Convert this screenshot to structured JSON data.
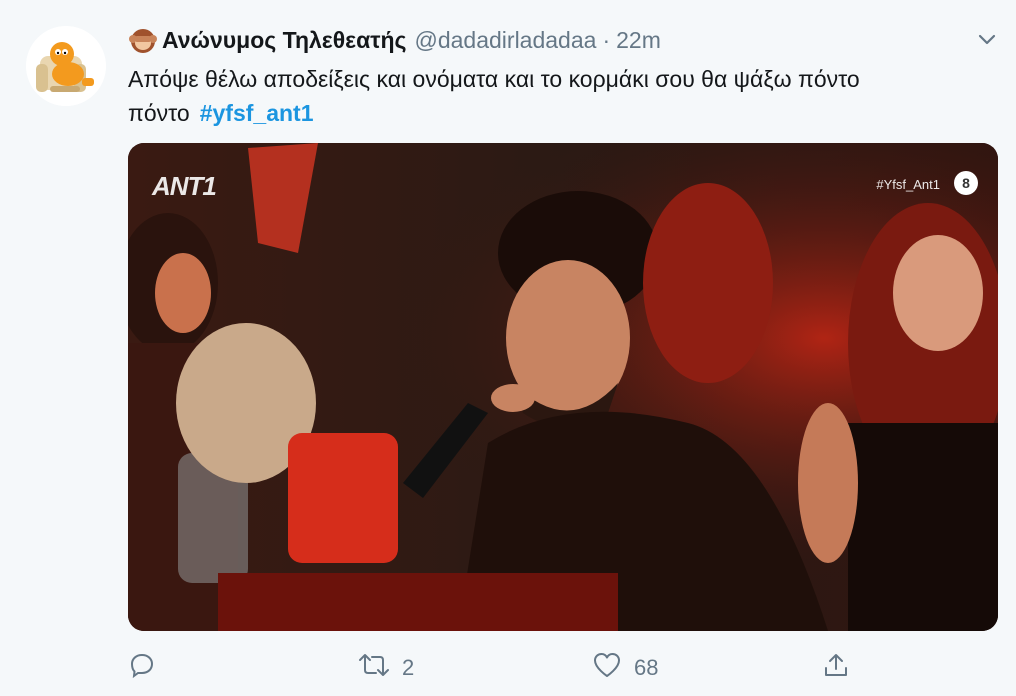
{
  "tweet": {
    "display_name": "Ανώνυμος Τηλεθεατής",
    "handle": "@dadadirladadaa",
    "separator": "·",
    "time": "22m",
    "text": "Απόψε θέλω αποδείξεις και ονόματα και το κορμάκι σου θα ψάξω πόντο πόντο",
    "hashtag": "#yfsf_ant1",
    "name_emoji": "see-no-evil-monkey-icon",
    "avatar": "garfield-avatar"
  },
  "media": {
    "channel_logo": "ANT1",
    "hashtag_overlay": "#Yfsf_Ant1",
    "rating_badge": "8"
  },
  "actions": {
    "reply_count": "",
    "retweet_count": "2",
    "like_count": "68"
  },
  "colors": {
    "background": "#f5f8fa",
    "text": "#14171a",
    "secondary": "#657786",
    "link": "#1b95e0"
  }
}
